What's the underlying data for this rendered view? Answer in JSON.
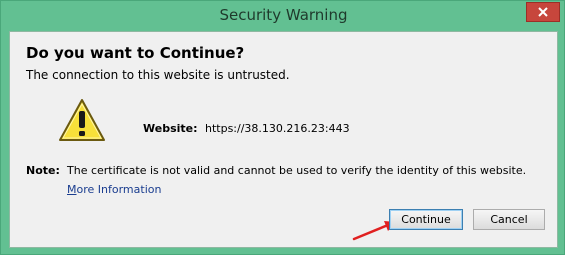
{
  "window": {
    "title": "Security Warning"
  },
  "dialog": {
    "heading": "Do you want to Continue?",
    "subheading": "The connection to this website is untrusted.",
    "website_label": "Website:",
    "website_url": "https://38.130.216.23:443",
    "note_label": "Note:",
    "note_text": "The certificate is not valid and cannot be used to verify the identity of this website.",
    "more_info_first": "M",
    "more_info_rest": "ore Information"
  },
  "buttons": {
    "continue": "Continue",
    "cancel": "Cancel"
  },
  "icons": {
    "warning": "warning-triangle-icon",
    "close": "close-icon",
    "arrow": "annotation-arrow-icon"
  },
  "colors": {
    "titlebar": "#62c092",
    "close": "#c7463c",
    "warning_fill": "#f7e03a",
    "arrow": "#e02020"
  }
}
